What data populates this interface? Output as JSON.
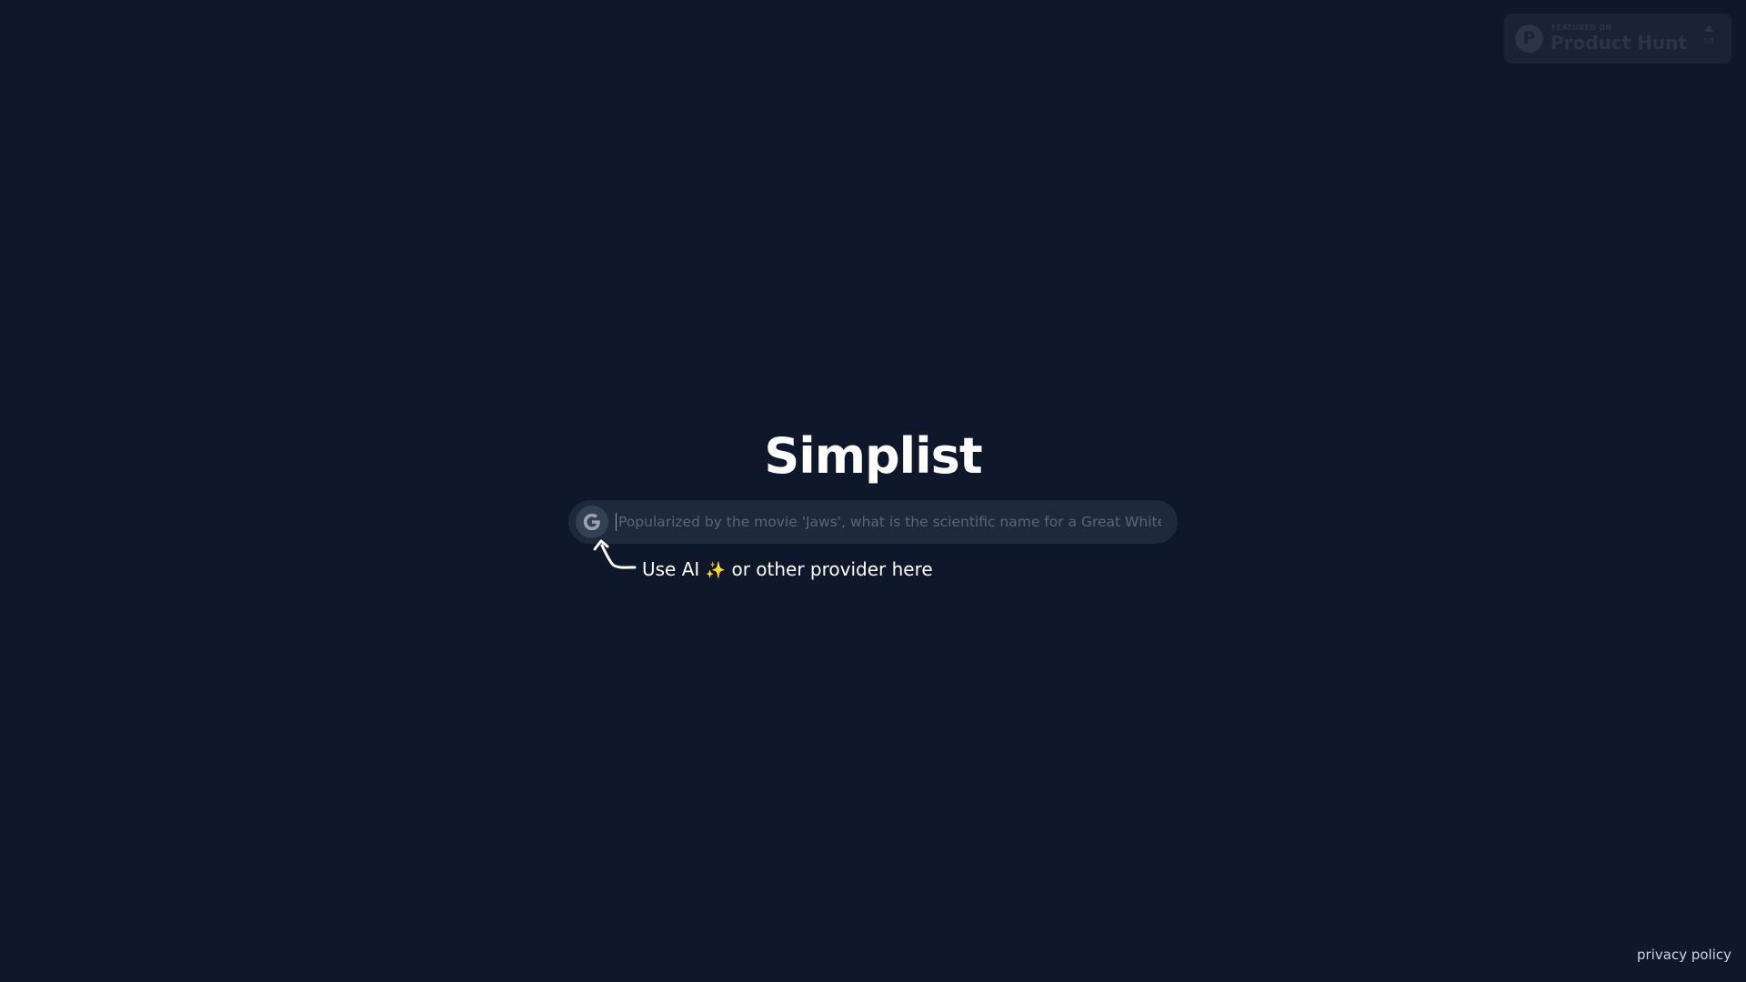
{
  "product_hunt": {
    "featured_label": "FEATURED ON",
    "title": "Product Hunt",
    "logo_letter": "P",
    "vote_count": "98"
  },
  "main": {
    "title": "Simplist",
    "search": {
      "placeholder": "Popularized by the movie 'Jaws', what is the scientific name for a Great White Shark?",
      "value": "",
      "provider_icon": "google-g-icon"
    },
    "hint": {
      "before_icon": "Use AI",
      "sparkle_icon": "sparkles-icon",
      "after_icon": "or other provider here"
    }
  },
  "footer": {
    "privacy_link": "privacy policy"
  },
  "colors": {
    "background": "#0f172a",
    "search_bar": "#1e293b",
    "sparkle": "#fbbf24"
  }
}
